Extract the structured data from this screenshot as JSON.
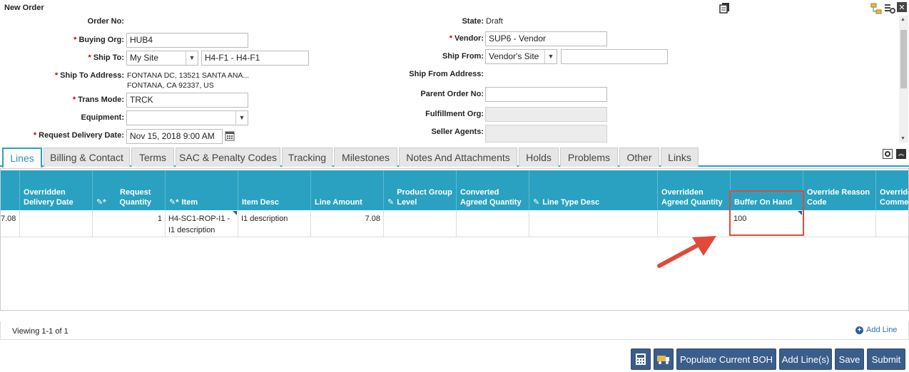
{
  "title": "New Order",
  "left": {
    "order_no_label": "Order No:",
    "buying_org_label": "Buying Org:",
    "buying_org": "HUB4",
    "ship_to_label": "Ship To:",
    "ship_to_select": "My Site",
    "ship_to_value": "H4-F1 - H4-F1",
    "ship_to_address_label": "Ship To Address:",
    "ship_to_address_1": "FONTANA DC, 13521 SANTA ANA...",
    "ship_to_address_2": "FONTANA, CA 92337, US",
    "trans_mode_label": "Trans Mode:",
    "trans_mode": "TRCK",
    "equipment_label": "Equipment:",
    "equipment": "",
    "request_delivery_label": "Request Delivery Date:",
    "request_delivery": "Nov 15, 2018 9:00 AM"
  },
  "right": {
    "state_label": "State:",
    "state": "Draft",
    "vendor_label": "Vendor:",
    "vendor": "SUP6 - Vendor",
    "ship_from_label": "Ship From:",
    "ship_from_select": "Vendor's Site",
    "ship_from_value": "",
    "ship_from_address_label": "Ship From Address:",
    "parent_order_label": "Parent Order No:",
    "parent_order": "",
    "fulfillment_org_label": "Fulfillment Org:",
    "seller_agents_label": "Seller Agents:"
  },
  "required_mark": "*",
  "tabs": [
    "Lines",
    "Billing & Contact",
    "Terms",
    "SAC & Penalty Codes",
    "Tracking",
    "Milestones",
    "Notes And Attachments",
    "Holds",
    "Problems",
    "Other",
    "Links"
  ],
  "columns": [
    "Overridden Delivery Date",
    "Request Quantity",
    "Item",
    "Item Desc",
    "Line Amount",
    "Product Group Level",
    "Converted Agreed Quantity",
    "Line Type Desc",
    "Overridden Agreed Quantity",
    "Buffer On Hand",
    "Override Reason Code",
    "Override Comme"
  ],
  "row": {
    "prev_amount": "7.08",
    "request_quantity": "1",
    "item": "H4-SC1-ROP-I1 - I1 description",
    "item_desc": "I1 description",
    "line_amount": "7.08",
    "buffer_on_hand": "100"
  },
  "footer": {
    "viewing": "Viewing 1-1 of 1",
    "add_line": "Add Line"
  },
  "buttons": {
    "populate": "Populate Current BOH",
    "add_lines": "Add Line(s)",
    "save": "Save",
    "submit": "Submit"
  },
  "colors": {
    "accent": "#2aa1c0",
    "button": "#3a5e8c",
    "highlight": "#e04a3a"
  }
}
